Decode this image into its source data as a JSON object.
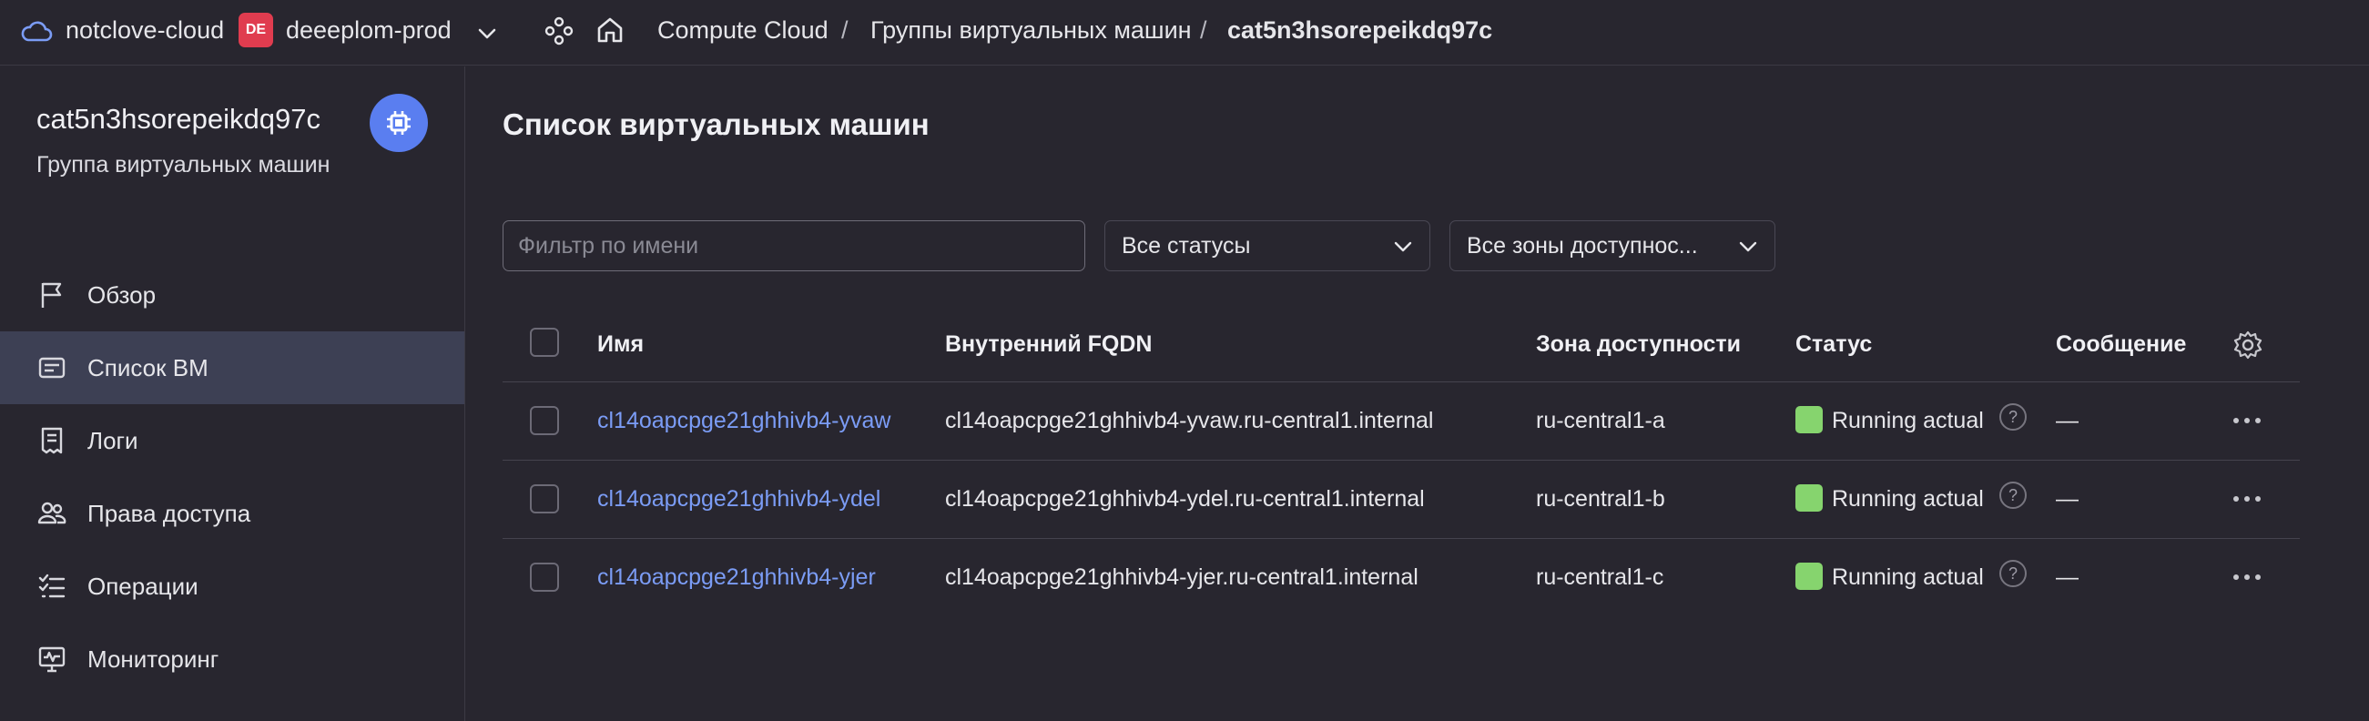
{
  "topbar": {
    "cloud_name": "notclove-cloud",
    "folder_badge": "DE",
    "folder_name": "deeeplom-prod",
    "breadcrumbs": [
      "Compute Cloud",
      "Группы виртуальных машин",
      "cat5n3hsorepeikdq97c"
    ],
    "separator": "/"
  },
  "sidebar": {
    "title": "cat5n3hsorepeikdq97c",
    "subtitle": "Группа виртуальных машин",
    "items": [
      {
        "label": "Обзор",
        "icon": "flag-icon"
      },
      {
        "label": "Список ВМ",
        "icon": "vm-list-icon",
        "active": true
      },
      {
        "label": "Логи",
        "icon": "logs-icon"
      },
      {
        "label": "Права доступа",
        "icon": "users-icon"
      },
      {
        "label": "Операции",
        "icon": "operations-icon"
      },
      {
        "label": "Мониторинг",
        "icon": "monitoring-icon"
      }
    ]
  },
  "main": {
    "title": "Список виртуальных машин",
    "filter_placeholder": "Фильтр по имени",
    "status_select": "Все статусы",
    "zone_select": "Все зоны доступнос...",
    "columns": [
      "Имя",
      "Внутренний FQDN",
      "Зона доступности",
      "Статус",
      "Сообщение"
    ],
    "rows": [
      {
        "name": "cl14oapcpge21ghhivb4-yvaw",
        "fqdn": "cl14oapcpge21ghhivb4-yvaw.ru-central1.internal",
        "zone": "ru-central1-a",
        "status": "Running actual",
        "message": "—"
      },
      {
        "name": "cl14oapcpge21ghhivb4-ydel",
        "fqdn": "cl14oapcpge21ghhivb4-ydel.ru-central1.internal",
        "zone": "ru-central1-b",
        "status": "Running actual",
        "message": "—"
      },
      {
        "name": "cl14oapcpge21ghhivb4-yjer",
        "fqdn": "cl14oapcpge21ghhivb4-yjer.ru-central1.internal",
        "zone": "ru-central1-c",
        "status": "Running actual",
        "message": "—"
      }
    ]
  },
  "colors": {
    "background": "#28262f",
    "accent": "#5a7ef0",
    "link": "#7b9cf5",
    "status_running": "#86d46e",
    "folder_badge": "#e03c4f"
  }
}
